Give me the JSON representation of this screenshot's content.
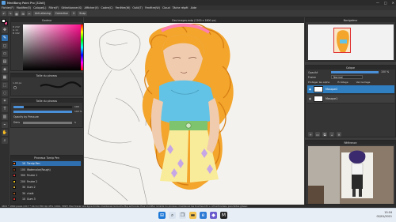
{
  "window": {
    "title": "MediBang Paint Pro [32bit]",
    "controls": [
      "—",
      "□",
      "✕"
    ]
  },
  "menu": [
    "Fichier(F)",
    "Modifier(E)",
    "Calque(L)",
    "Filtre(F)",
    "Sélectionner(S)",
    "Afficher(V)",
    "Cadre(C)",
    "Fenêtre(W)",
    "Outil(T)",
    "Fenêtre(W)",
    "Cloud",
    "Tâche répét",
    "Aide"
  ],
  "toolbar": {
    "items": [
      "↶",
      "↷",
      "▦",
      "⊞",
      "✂"
    ],
    "antialias_label": "Anti-aliasing",
    "correction_label": "Correction",
    "correction_value": "0",
    "snap_label": "Snap"
  },
  "panels": {
    "color": {
      "title": "Couleur",
      "values": [
        "R 242",
        "G 11",
        "B 182"
      ]
    },
    "brush": {
      "title": "Taille du pinceau",
      "size": "1.00 px"
    },
    "brush_settings": {
      "title": "Taille du pinceau",
      "size_value": "100",
      "opacity_value": "100 %",
      "pressure_label": "Opacity by Pressure",
      "density_label": "Dens",
      "density_value": "5"
    },
    "brushes": {
      "title": "Pinceaux Turnip Pen",
      "items": [
        {
          "num": "10",
          "name": "Turnip Pen",
          "color": "#e0702a",
          "selected": true
        },
        {
          "num": "100",
          "name": "Watercolor(Rough)",
          "color": "#7a3b1a",
          "selected": false
        },
        {
          "num": "300",
          "name": "Feutre 1",
          "color": "#d63a3a",
          "selected": false
        },
        {
          "num": "200",
          "name": "Feutre 2",
          "color": "#e6c21a",
          "selected": false
        },
        {
          "num": "30",
          "name": "Gum 2",
          "color": "#d9b13a",
          "selected": false
        },
        {
          "num": "30",
          "name": "chalk",
          "color": "#a35a2a",
          "selected": false
        },
        {
          "num": "10",
          "name": "Gum 3",
          "color": "#cc3030",
          "selected": false
        }
      ]
    }
  },
  "canvas": {
    "tab_title": "Des Images.mdp (1200 x 1800 px)"
  },
  "right": {
    "navigator_title": "Navigateur",
    "layer_title": "Calque",
    "opacity_label": "Opacité",
    "opacity_value": "100 %",
    "blend_label": "Fusion",
    "blend_value": "Normal",
    "checkboxes": [
      "Protéger les alpha",
      "Écrêtage",
      "Verrouillage"
    ],
    "layers": [
      {
        "name": "Masque2",
        "selected": true
      },
      {
        "name": "Masque1",
        "selected": false
      }
    ],
    "reference_title": "Référence"
  },
  "status": {
    "text": "4654 * 1800 pixels (29.7 * 21cm) 350 dpi 45% (1912, 3097) Pour tracer une ligne droite, maintenez la touche Maj enfoncée. Pour modifier la taille du pinceau, maintenez les touches Ctrl + Alt enfoncées, puis faites glisser."
  },
  "taskbar": {
    "time": "13:16",
    "date": "02/01/2021"
  }
}
